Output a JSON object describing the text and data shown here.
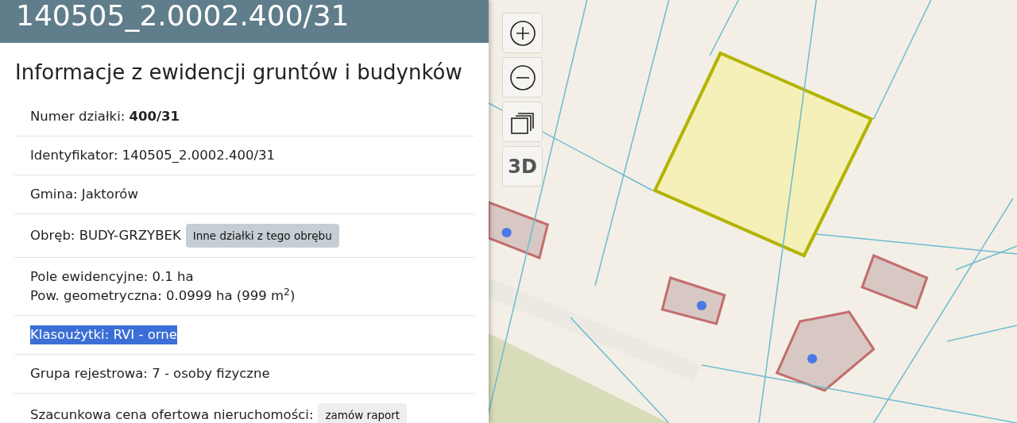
{
  "header": {
    "title": "140505_2.0002.400/31"
  },
  "section": {
    "heading": "Informacje z ewidencji gruntów i budynków"
  },
  "rows": [
    {
      "lines": [
        "Numer działki: **400/31**"
      ],
      "highlighted": false
    },
    {
      "lines": [
        "Identyfikator: 140505_2.0002.400/31"
      ],
      "highlighted": false
    },
    {
      "lines": [
        "Gmina: Jaktorów"
      ],
      "highlighted": false
    },
    {
      "lines": [
        "Obręb: BUDY-GRZYBEK"
      ],
      "highlighted": false,
      "button": {
        "label": "Inne działki z tego obrębu",
        "kind": "secondary"
      }
    },
    {
      "lines": [
        "Pole ewidencyjne: 0.1 ha",
        "Pow. geometryczna: 0.0999 ha (999 m$^{2}$)"
      ],
      "highlighted": false
    },
    {
      "lines": [
        "Klasoużytki: RVI - orne"
      ],
      "highlighted": true
    },
    {
      "lines": [
        "Grupa rejestrowa: 7 - osoby fizyczne"
      ],
      "highlighted": false
    },
    {
      "lines": [
        "Szacunkowa cena ofertowa nieruchomości:"
      ],
      "highlighted": false,
      "button": {
        "label": "zamów raport",
        "kind": "light"
      }
    }
  ],
  "map": {
    "controls": [
      {
        "kind": "zoom-in"
      },
      {
        "kind": "zoom-out"
      },
      {
        "kind": "layers"
      },
      {
        "kind": "text",
        "label": "3D"
      }
    ]
  }
}
